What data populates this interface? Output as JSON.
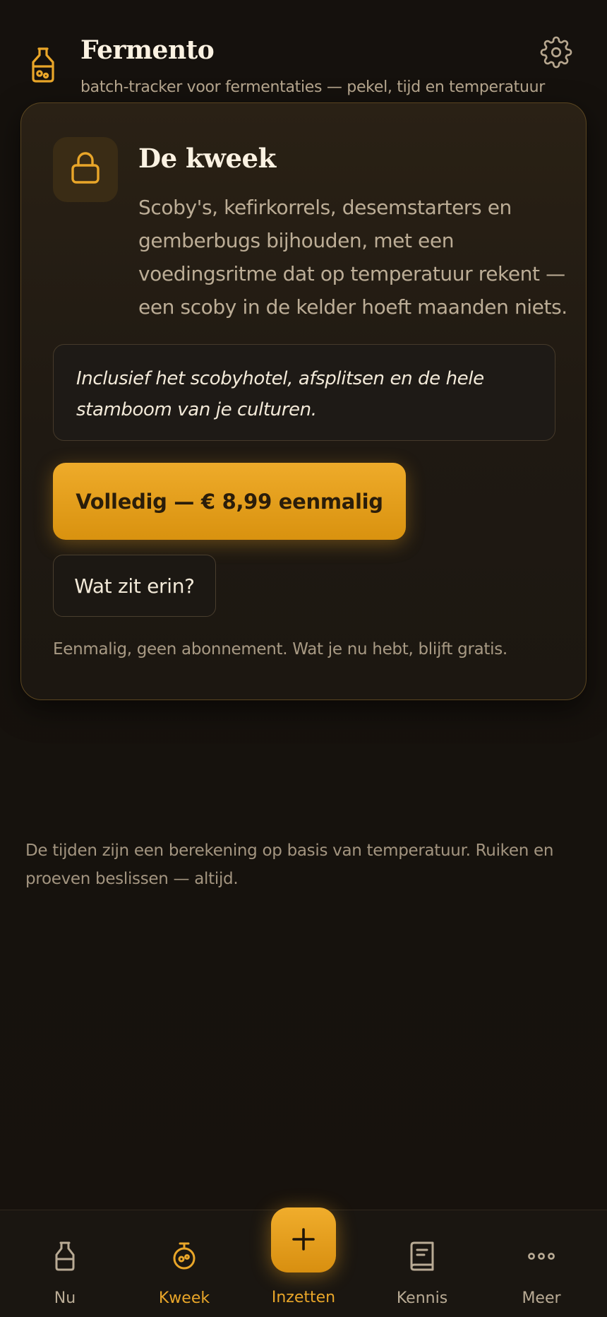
{
  "header": {
    "title": "Fermento",
    "subtitle": "batch-tracker voor fermentaties — pekel, tijd en temperatuur",
    "app_icon": "jar-icon",
    "settings_icon": "gear-icon"
  },
  "upsell": {
    "icon": "lock-icon",
    "title": "De kweek",
    "description": "Scoby's, kefirkorrels, desemstarters en gemberbugs bijhouden, met een voedingsritme dat op temperatuur rekent — een scoby in de kelder hoeft maanden niets.",
    "highlight": "Inclusief het scobyhotel, afsplitsen en de hele stamboom van je culturen.",
    "buy_label": "Volledig — € 8,99 eenmalig",
    "info_label": "Wat zit erin?",
    "footnote": "Eenmalig, geen abonnement. Wat je nu hebt, blijft gratis."
  },
  "disclaimer": "De tijden zijn een berekening op basis van temperatuur. Ruiken en proeven beslissen — altijd.",
  "nav": {
    "items": [
      {
        "label": "Nu",
        "icon": "bottle-icon",
        "active": false
      },
      {
        "label": "Kweek",
        "icon": "culture-jar-icon",
        "active": true
      },
      {
        "label": "Inzetten",
        "icon": "plus-icon",
        "active": false
      },
      {
        "label": "Kennis",
        "icon": "book-icon",
        "active": false
      },
      {
        "label": "Meer",
        "icon": "more-dots-icon",
        "active": false
      }
    ]
  },
  "colors": {
    "accent": "#e9a629",
    "background": "#16120e",
    "card_border": "#5a4520",
    "text_primary": "#fbf2e2",
    "text_muted": "#b7a78f"
  }
}
